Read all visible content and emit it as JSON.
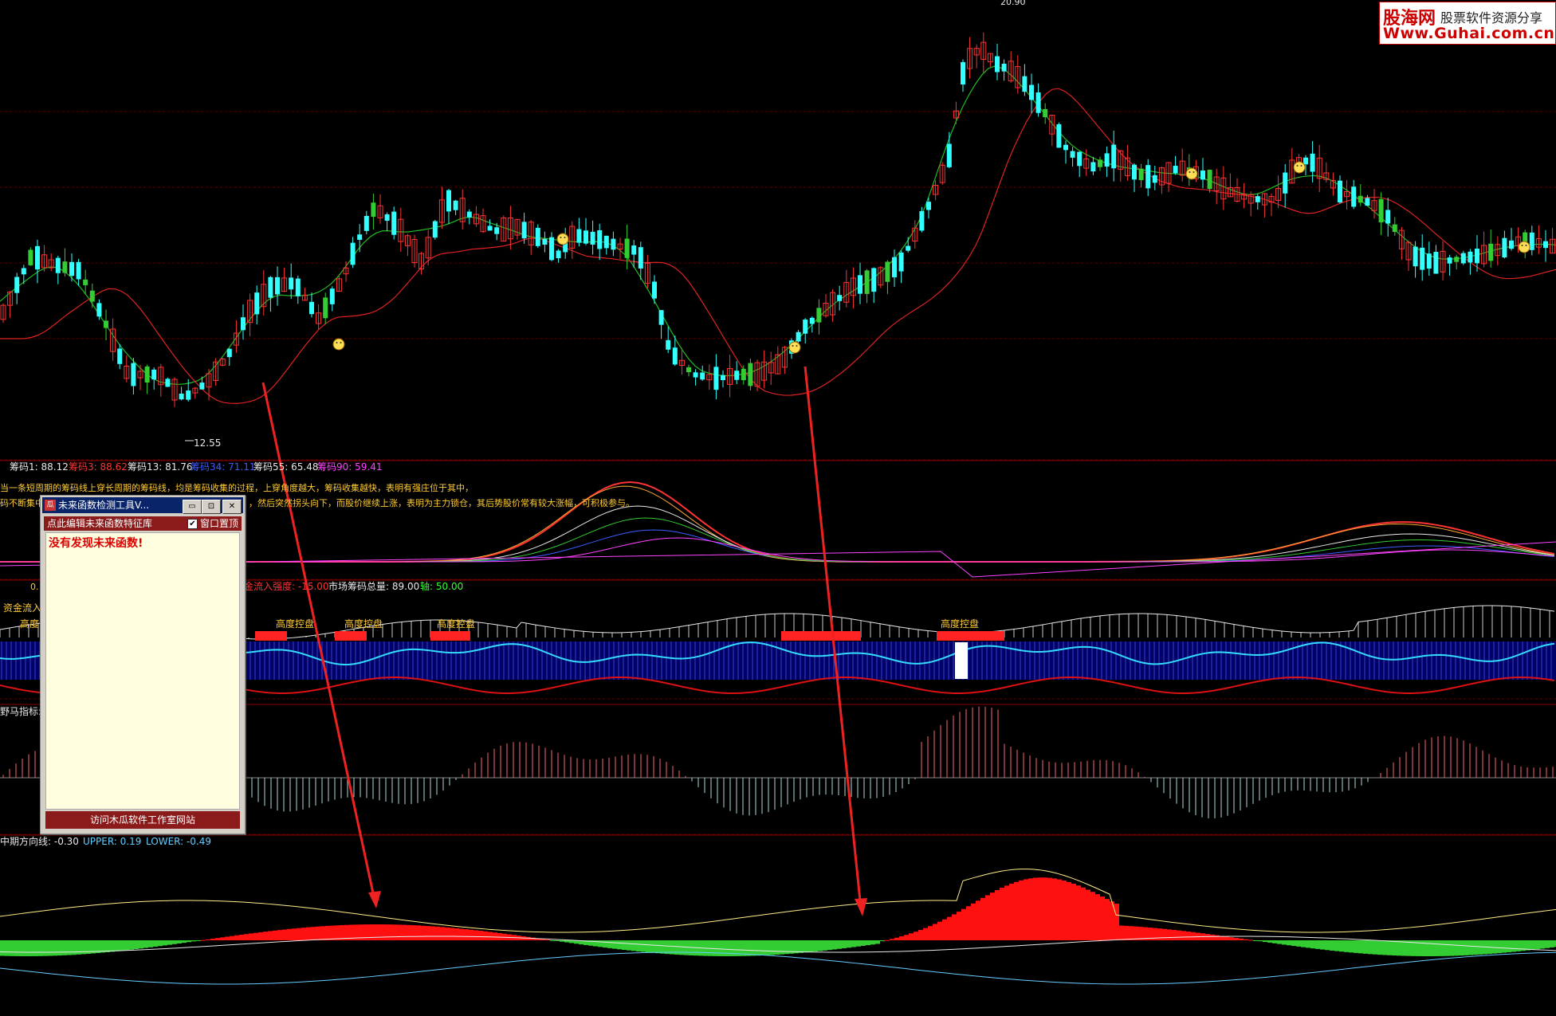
{
  "watermark": {
    "site_cn": "股海网",
    "tagline": "股票软件资源分享",
    "url": "Www.Guhai.com.cn"
  },
  "main_chart": {
    "low_label": "12.55",
    "high_label": "20.90"
  },
  "chip_panel": {
    "legend": [
      {
        "text": "筹码1: 88.12",
        "color": "#e8e8e8"
      },
      {
        "text": "筹码3: 88.62",
        "color": "#ff3333"
      },
      {
        "text": "筹码13: 81.76",
        "color": "#e8e8e8"
      },
      {
        "text": "筹码34: 71.11",
        "color": "#3a5cff"
      },
      {
        "text": "筹码55: 65.48",
        "color": "#e8e8e8"
      },
      {
        "text": "筹码90: 59.41",
        "color": "#ff44ff"
      }
    ],
    "note_line1": "当一条短周期的筹码线上穿长周期的筹码线，均是筹码收集的过程，上穿角度越大，筹码收集越快，表明有强庄位于其中，",
    "note_line2": "码不断集中",
    "note_line2b": "，然后突然拐头向下，而股价继续上涨，表明为主力锁仓，其后势股价常有较大涨幅，可积极参与。"
  },
  "fund_panel": {
    "label_left": "0.",
    "label_left2": "资金流入",
    "legend": [
      {
        "text": "金流入强度: -15.00",
        "color": "#ff3333"
      },
      {
        "text": "市场筹码总量: 89.00",
        "color": "#e8e8e8"
      },
      {
        "text": "轴: 50.00",
        "color": "#33ff33"
      }
    ],
    "marks": [
      "高度",
      "高度控盘",
      "高度控盘",
      "高度控盘",
      "高度控盘"
    ]
  },
  "horse_panel": {
    "label": "野马指标:"
  },
  "direction_panel": {
    "legend": [
      {
        "text": "中期方向线: -0.30",
        "color": "#e8e8e8"
      },
      {
        "text": "UPPER: 0.19",
        "color": "#66ccff"
      },
      {
        "text": "LOWER: -0.49",
        "color": "#66ccff"
      }
    ]
  },
  "tool_window": {
    "title": "未来函数检测工具V...",
    "app_icon": "瓜",
    "btn_min": "▭",
    "btn_max": "⊡",
    "btn_close": "✕",
    "bar_text": "点此编辑未来函数特征库",
    "topmost_check": "✔",
    "topmost_label": "窗口置顶",
    "message": "没有发现未来函数!",
    "footer": "访问木瓜软件工作室网站"
  },
  "colors": {
    "up": "#ff3333",
    "down": "#33ffff",
    "green": "#33cc33",
    "grid": "#8b0000"
  },
  "chart_data": {
    "type": "candlestick",
    "price_range": [
      12.55,
      20.9
    ],
    "series": [
      {
        "name": "筹码1",
        "value": 88.12
      },
      {
        "name": "筹码3",
        "value": 88.62
      },
      {
        "name": "筹码13",
        "value": 81.76
      },
      {
        "name": "筹码34",
        "value": 71.11
      },
      {
        "name": "筹码55",
        "value": 65.48
      },
      {
        "name": "筹码90",
        "value": 59.41
      },
      {
        "name": "市场筹码总量",
        "value": 89.0
      },
      {
        "name": "轴",
        "value": 50.0
      },
      {
        "name": "中期方向线",
        "value": -0.3
      },
      {
        "name": "UPPER",
        "value": 0.19
      },
      {
        "name": "LOWER",
        "value": -0.49
      }
    ]
  }
}
